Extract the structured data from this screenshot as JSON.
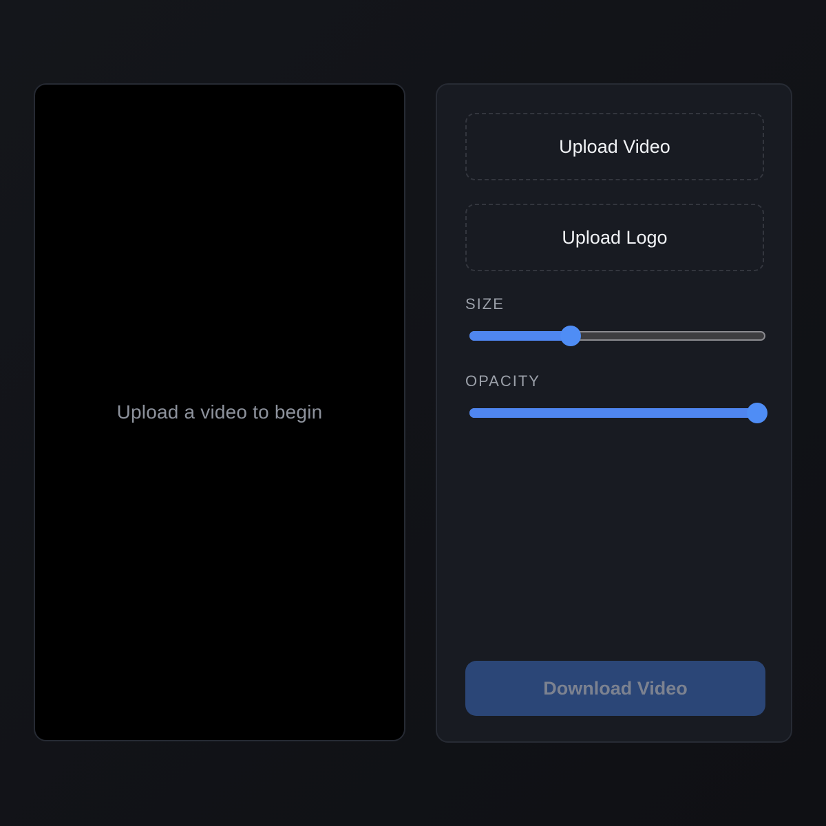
{
  "preview": {
    "message": "Upload a video to begin"
  },
  "controls": {
    "upload_video_label": "Upload Video",
    "upload_logo_label": "Upload Logo",
    "size": {
      "label": "SIZE",
      "value_percent": 34
    },
    "opacity": {
      "label": "OPACITY",
      "value_percent": 100
    },
    "download_label": "Download Video",
    "download_enabled": false
  },
  "colors": {
    "accent": "#4f86f0",
    "panel": "#181b22",
    "preview_bg": "#000000",
    "download_disabled": "#2b4677"
  }
}
